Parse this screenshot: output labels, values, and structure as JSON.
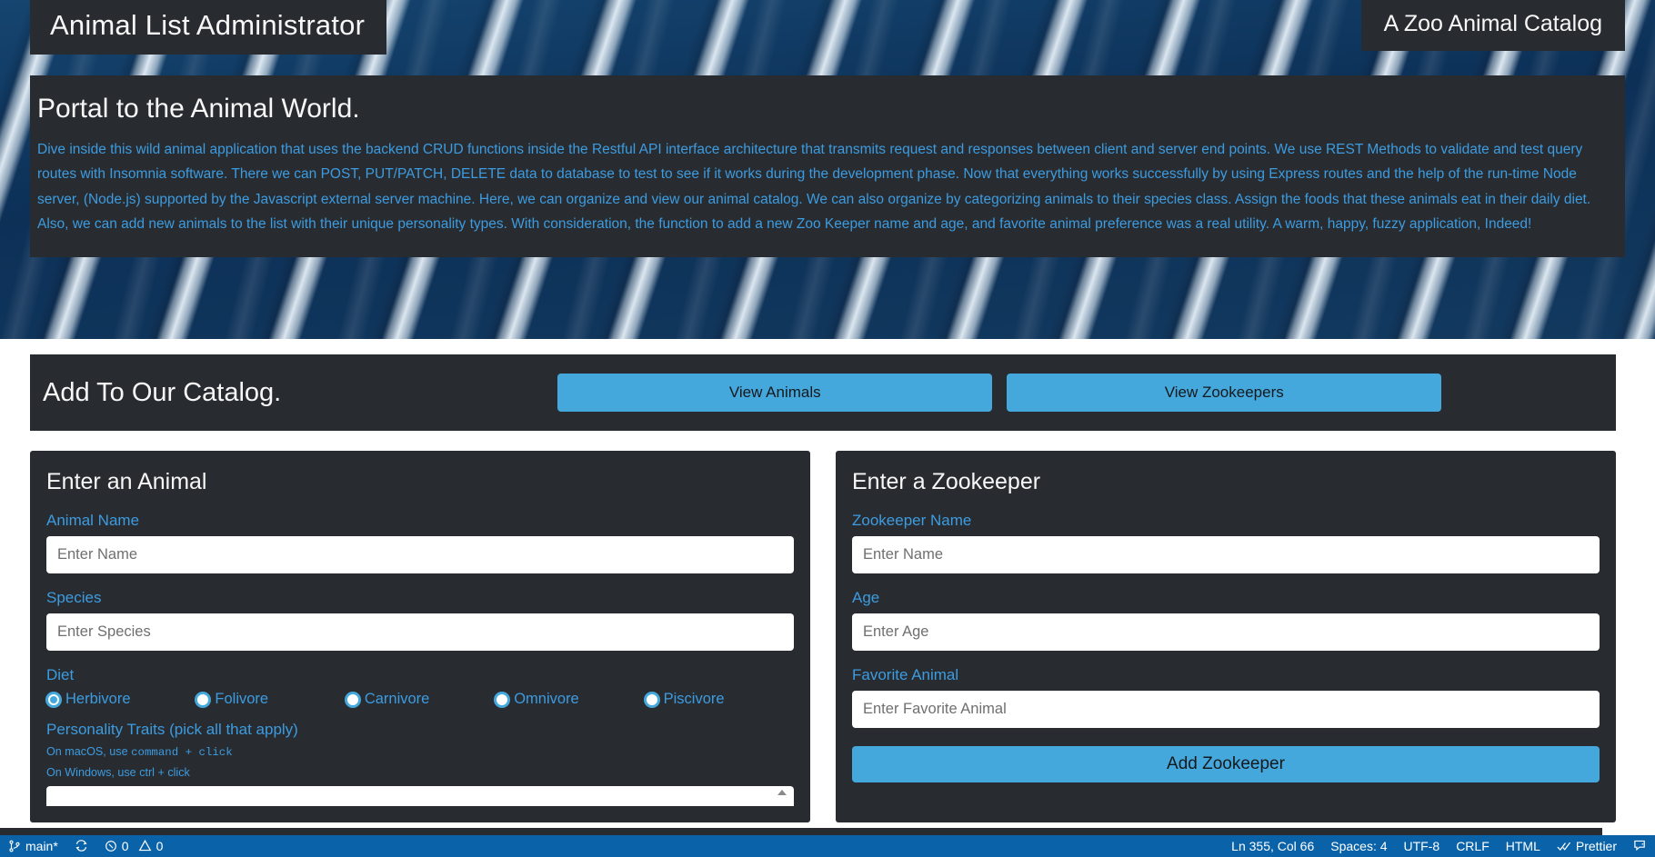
{
  "header": {
    "title": "Animal List Administrator",
    "subtitle": "A Zoo Animal Catalog"
  },
  "portal": {
    "heading": "Portal to the Animal World.",
    "paragraph": "Dive inside this wild animal application that uses the backend CRUD functions inside the Restful API interface architecture that transmits request and responses between client and server end points. We use REST Methods to validate and test query routes with Insomnia software. There we can POST, PUT/PATCH, DELETE data to database to test to see if it works during the development phase. Now that everything works successfully by using Express routes and the help of the run-time Node server, (Node.js) supported by the Javascript external server machine. Here, we can organize and view our animal catalog. We can also organize by categorizing animals to their species class. Assign the foods that these animals eat in their daily diet. Also, we can add new animals to the list with their unique personality types. With consideration, the function to add a new Zoo Keeper name and age, and favorite animal preference was a real utility. A warm, happy, fuzzy application, Indeed!"
  },
  "catalog": {
    "heading": "Add To Our Catalog.",
    "view_animals_label": "View Animals",
    "view_zookeepers_label": "View Zookeepers"
  },
  "animal_form": {
    "heading": "Enter an Animal",
    "name_label": "Animal Name",
    "name_placeholder": "Enter Name",
    "name_value": "",
    "species_label": "Species",
    "species_placeholder": "Enter Species",
    "species_value": "",
    "diet_label": "Diet",
    "diet_options": [
      {
        "label": "Herbivore",
        "checked": true
      },
      {
        "label": "Folivore",
        "checked": false
      },
      {
        "label": "Carnivore",
        "checked": false
      },
      {
        "label": "Omnivore",
        "checked": false
      },
      {
        "label": "Piscivore",
        "checked": false
      }
    ],
    "traits_label": "Personality Traits (pick all that apply)",
    "hint_mac_prefix": "On macOS, use ",
    "hint_mac_code": "command + click",
    "hint_win": "On Windows, use ctrl + click"
  },
  "zookeeper_form": {
    "heading": "Enter a Zookeeper",
    "name_label": "Zookeeper Name",
    "name_placeholder": "Enter Name",
    "name_value": "",
    "age_label": "Age",
    "age_placeholder": "Enter Age",
    "age_value": "",
    "favorite_label": "Favorite Animal",
    "favorite_placeholder": "Enter Favorite Animal",
    "favorite_value": "",
    "submit_label": "Add Zookeeper"
  },
  "statusbar": {
    "branch": "main*",
    "errors": "0",
    "warnings": "0",
    "cursor": "Ln 355, Col 66",
    "spaces": "Spaces: 4",
    "encoding": "UTF-8",
    "eol": "CRLF",
    "language": "HTML",
    "formatter": "Prettier"
  },
  "colors": {
    "accent": "#45a8dd",
    "link": "#3d9be0",
    "panel": "#282c30",
    "statusbar": "#0a63a8",
    "hero": "#123c63"
  }
}
